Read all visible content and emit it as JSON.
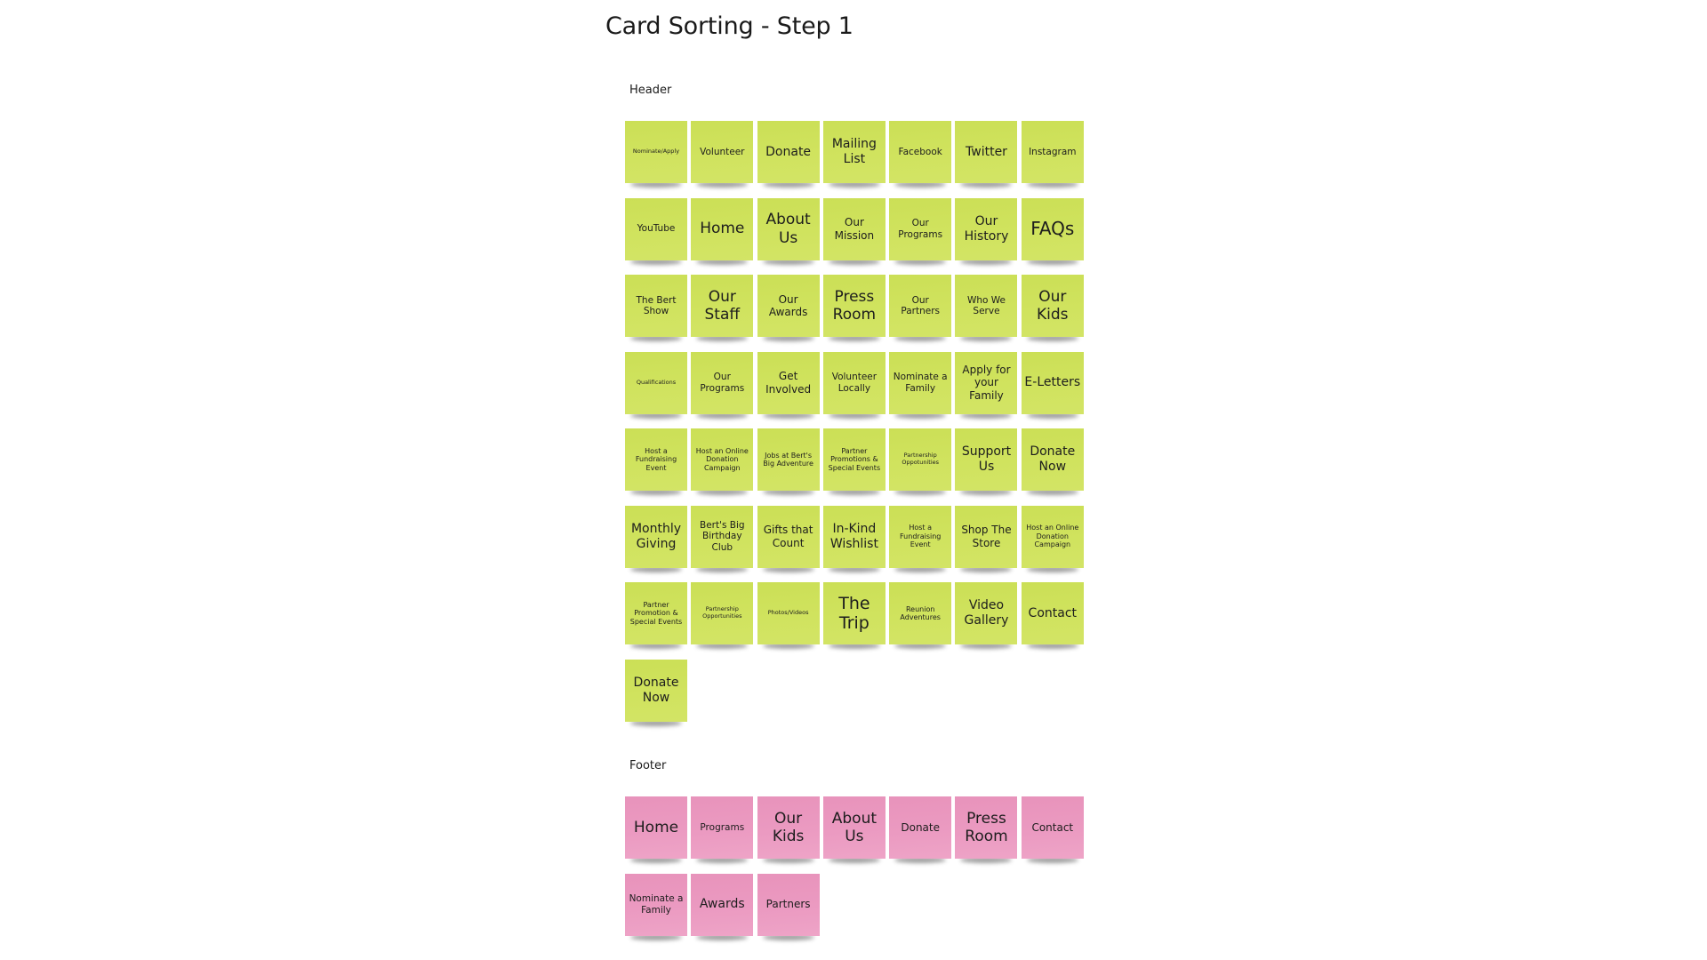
{
  "title": "Card Sorting - Step 1",
  "colors": {
    "header_card": "#cde05a",
    "footer_card": "#eb9ac1",
    "background": "#ffffff"
  },
  "header": {
    "label": "Header",
    "cards": [
      "Nominate/Apply",
      "Volunteer",
      "Donate",
      "Mailing List",
      "Facebook",
      "Twitter",
      "Instagram",
      "YouTube",
      "Home",
      "About Us",
      "Our Mission",
      "Our Programs",
      "Our History",
      "FAQs",
      "The Bert Show",
      "Our Staff",
      "Our Awards",
      "Press Room",
      "Our Partners",
      "Who We Serve",
      "Our Kids",
      "Qualifications",
      "Our Programs",
      "Get Involved",
      "Volunteer Locally",
      "Nominate a Family",
      "Apply for your Family",
      "E-Letters",
      "Host a Fundraising Event",
      "Host an Online Donation Campaign",
      "Jobs at Bert's Big Adventure",
      "Partner Promotions & Special Events",
      "Partnership Oppotunities",
      "Support Us",
      "Donate Now",
      "Monthly Giving",
      "Bert's Big Birthday Club",
      "Gifts that Count",
      "In-Kind Wishlist",
      "Host a Fundraising Event",
      "Shop The Store",
      "Host an Online Donation Campaign",
      "Partner Promotion & Special Events",
      "Partnership Opportunities",
      "Photos/Videos",
      "The Trip",
      "Reunion Adventures",
      "Video Gallery",
      "Contact",
      "Donate Now"
    ]
  },
  "footer": {
    "label": "Footer",
    "cards": [
      "Home",
      "Programs",
      "Our Kids",
      "About Us",
      "Donate",
      "Press Room",
      "Contact",
      "Nominate a Family",
      "Awards",
      "Partners"
    ]
  }
}
